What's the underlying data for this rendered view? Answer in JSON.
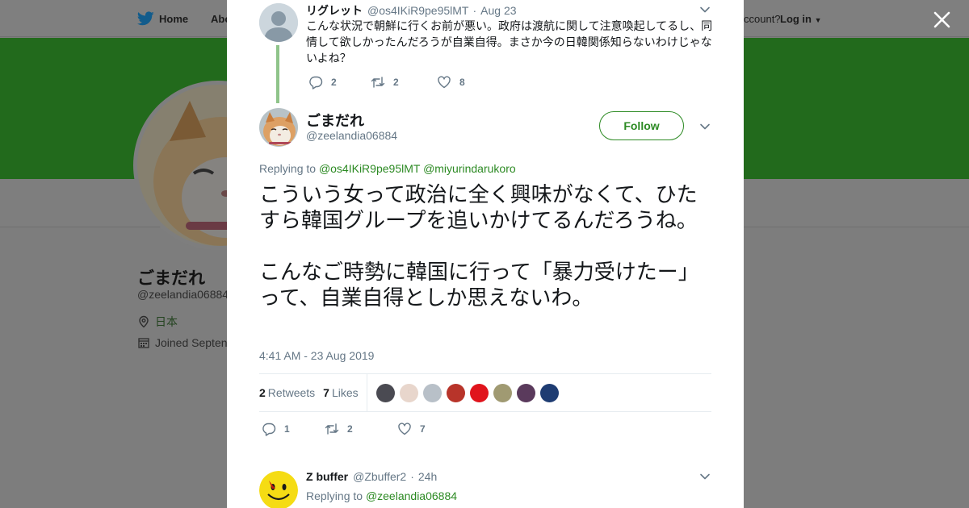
{
  "background": {
    "nav": {
      "home": "Home",
      "about": "Abo",
      "account_prompt": "ccount?",
      "login": "Log in"
    },
    "profile": {
      "name": "ごまだれ",
      "handle": "@zeelandia06884",
      "location": "日本",
      "joined": "Joined Septen"
    },
    "colors": {
      "banner": "#226a1c",
      "accent": "#2c8a23"
    }
  },
  "parent_tweet": {
    "name": "リグレット",
    "handle": "@os4IKiR9pe95lMT",
    "separator": "·",
    "date": "Aug 23",
    "text": "こんな状況で朝鮮に行くお前が悪い。政府は渡航に関して注意喚起してるし、同情して欲しかったんだろうが自業自得。まさか今の日韓関係知らないわけじゃないよね？",
    "replies": "2",
    "retweets": "2",
    "likes": "8"
  },
  "main_tweet": {
    "name": "ごまだれ",
    "handle": "@zeelandia06884",
    "follow_label": "Follow",
    "replying_prefix": "Replying to",
    "replying_to_1": "@os4IKiR9pe95lMT",
    "replying_to_2": "@miyurindarukoro",
    "text_para1": "こういう女って政治に全く興味がなくて、ひたすら韓国グループを追いかけてるんだろうね。",
    "text_para2": "こんなご時勢に韓国に行って「暴力受けたー」って、自業自得としか思えないわ。",
    "timestamp": "4:41 AM - 23 Aug 2019",
    "retweet_count": "2",
    "retweet_label": "Retweets",
    "like_count": "7",
    "like_label": "Likes",
    "liker_avatar_colors": [
      "#4a4a52",
      "#e8d6cc",
      "#b8c0c8",
      "#b8342a",
      "#e0141c",
      "#a09a72",
      "#5a3a5c",
      "#1e3c72"
    ],
    "replies": "1",
    "retweets": "2",
    "likes": "7"
  },
  "reply_tweet": {
    "name": "Z buffer",
    "handle": "@Zbuffer2",
    "separator": "·",
    "date": "24h",
    "replying_prefix": "Replying to",
    "replying_to": "@zeelandia06884"
  }
}
